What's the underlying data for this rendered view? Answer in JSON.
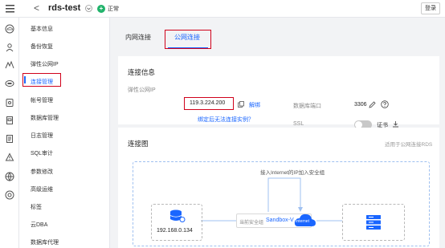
{
  "header": {
    "back_glyph": "<",
    "title": "rds-test",
    "status_label": "正常",
    "status_glyph": "+",
    "login_label": "登录"
  },
  "sidebar": {
    "items": [
      {
        "label": "基本信息"
      },
      {
        "label": "备份恢复"
      },
      {
        "label": "弹性公网IP"
      },
      {
        "label": "连接管理",
        "active": true
      },
      {
        "label": "帐号管理"
      },
      {
        "label": "数据库管理"
      },
      {
        "label": "日志管理"
      },
      {
        "label": "SQL审计"
      },
      {
        "label": "参数修改"
      },
      {
        "label": "高级运维"
      },
      {
        "label": "标签"
      },
      {
        "label": "云DBA"
      },
      {
        "label": "数据库代理"
      }
    ]
  },
  "tabs": [
    {
      "label": "内网连接",
      "active": false
    },
    {
      "label": "公网连接",
      "active": true
    }
  ],
  "connection_info": {
    "title": "连接信息",
    "eip_label": "弹性公网IP",
    "eip_value": "119.3.224.200",
    "unbind_label": "解绑",
    "help_link": "绑定后无法连接实例？",
    "port_label": "数据库端口",
    "port_value": "3306",
    "ssl_label": "SSL",
    "ssl_enabled": false,
    "cert_label": "证书"
  },
  "diagram": {
    "title": "连接图",
    "note": "适用于公网连接RDS",
    "add_to_sg": "接入Internet的IP加入安全组",
    "client_ip": "192.168.0.134",
    "sg_label": "当前安全组",
    "sg_name": "Sandbox-V",
    "internet_label": "Internet"
  },
  "colors": {
    "accent": "#1a66ff",
    "highlight": "#d0021b",
    "status_green": "#21b36b"
  },
  "icons": [
    "menu-icon",
    "back-icon",
    "dropdown-icon",
    "copy-icon",
    "edit-icon",
    "help-icon",
    "download-icon",
    "database-icon",
    "server-icon",
    "cloud-icon"
  ]
}
